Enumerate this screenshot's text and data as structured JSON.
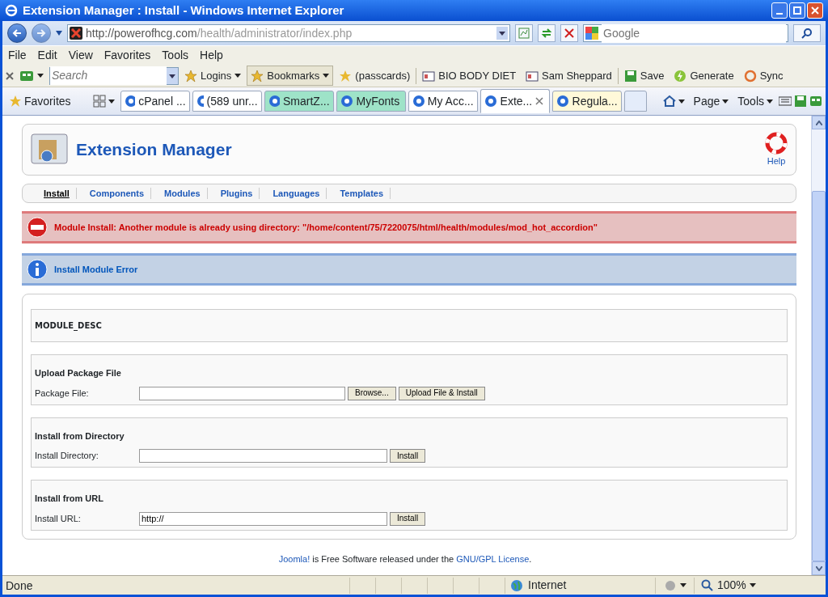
{
  "window": {
    "title": "Extension Manager : Install - Windows Internet Explorer"
  },
  "address_bar": {
    "url_host": "http://powerofhcg.com",
    "url_path": "/health/administrator/index.php"
  },
  "web_search": {
    "placeholder": "Google"
  },
  "menu": [
    "File",
    "Edit",
    "View",
    "Favorites",
    "Tools",
    "Help"
  ],
  "toolbar": {
    "search_placeholder": "Search",
    "items": [
      {
        "label": "Logins",
        "kind": "dropdown"
      },
      {
        "label": "Bookmarks",
        "kind": "dropdown"
      },
      {
        "label": "(passcards)",
        "kind": "plain"
      },
      {
        "label": "BIO BODY DIET",
        "kind": "card"
      },
      {
        "label": "Sam Sheppard",
        "kind": "card"
      },
      {
        "label": "Save",
        "kind": "save"
      },
      {
        "label": "Generate",
        "kind": "generate"
      },
      {
        "label": "Sync",
        "kind": "sync"
      }
    ]
  },
  "favorites_bar": {
    "label": "Favorites",
    "tabs": [
      {
        "label": "cPanel ...",
        "selected": false,
        "color": "#ffffff"
      },
      {
        "label": "(589 unr...",
        "selected": false,
        "color": "#ffffff"
      },
      {
        "label": "SmartZ...",
        "selected": false,
        "color": "#9ee3c8"
      },
      {
        "label": "MyFonts",
        "selected": false,
        "color": "#9ee3c8"
      },
      {
        "label": "My Acc...",
        "selected": false,
        "color": "#ffffff"
      },
      {
        "label": "Exte...",
        "selected": true,
        "color": "#ffffff"
      },
      {
        "label": "Regula...",
        "selected": false,
        "color": "#fff9d9"
      }
    ],
    "commands": [
      "Page",
      "Tools"
    ]
  },
  "page": {
    "title": "Extension Manager",
    "help": "Help",
    "subnav": [
      {
        "label": "Install",
        "selected": true
      },
      {
        "label": "Components",
        "selected": false
      },
      {
        "label": "Modules",
        "selected": false
      },
      {
        "label": "Plugins",
        "selected": false
      },
      {
        "label": "Languages",
        "selected": false
      },
      {
        "label": "Templates",
        "selected": false
      }
    ],
    "error": "Module Install: Another module is already using directory: \"/home/content/75/7220075/html/health/modules/mod_hot_accordion\"",
    "info": "Install Module Error",
    "module_desc": "MODULE_DESC",
    "sections": [
      {
        "title": "Upload Package File",
        "field_label": "Package File:",
        "wide": false,
        "buttons": [
          "Browse...",
          "Upload File & Install"
        ]
      },
      {
        "title": "Install from Directory",
        "field_label": "Install Directory:",
        "wide": true,
        "buttons": [
          "Install"
        ]
      },
      {
        "title": "Install from URL",
        "field_label": "Install URL:",
        "value": "http://",
        "wide": true,
        "buttons": [
          "Install"
        ]
      }
    ],
    "footer": [
      {
        "text": "Joomla!",
        "link": true
      },
      {
        "text": " is Free Software released under the ",
        "link": false
      },
      {
        "text": "GNU/GPL License",
        "link": true
      },
      {
        "text": ".",
        "link": false
      }
    ]
  },
  "status_bar": {
    "text": "Done",
    "zone": "Internet",
    "zoom": "100%"
  }
}
